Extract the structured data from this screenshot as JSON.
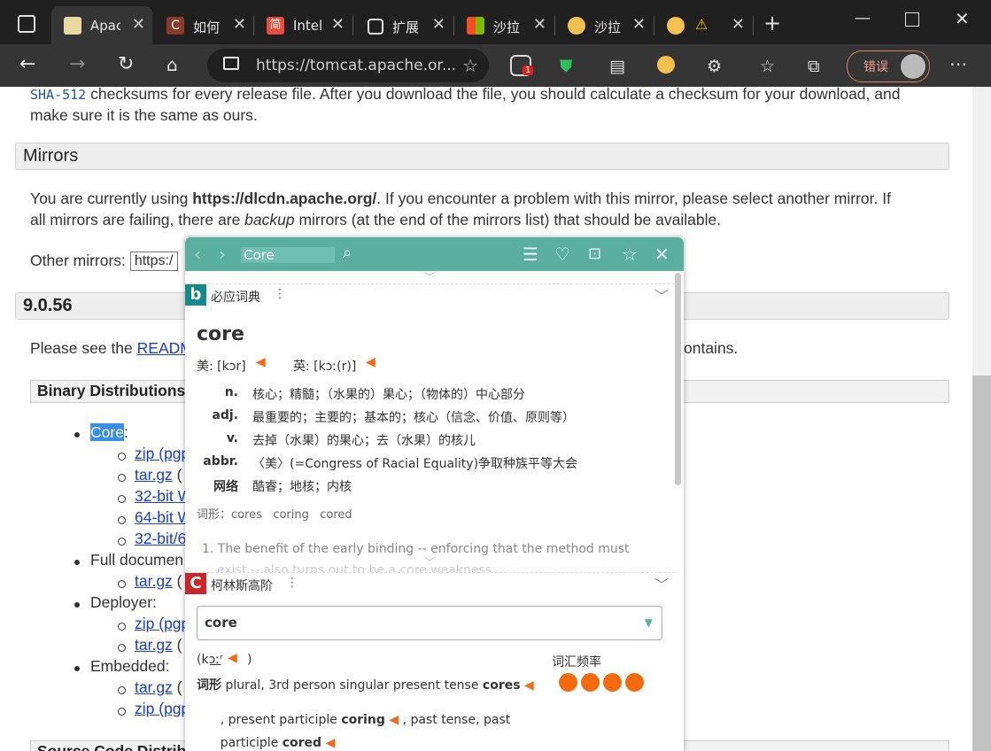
{
  "browser": {
    "tabs": [
      {
        "label": "Apac",
        "icon": "tomcat-icon",
        "active": true
      },
      {
        "label": "如何",
        "icon": "c-icon"
      },
      {
        "label": "Intel",
        "icon": "jian-icon"
      },
      {
        "label": "扩展",
        "icon": "puzzle-icon"
      },
      {
        "label": "沙拉",
        "icon": "windows-icon"
      },
      {
        "label": "沙拉",
        "icon": "saladict-icon"
      },
      {
        "label": "",
        "icon": "saladict-icon"
      }
    ],
    "url": "https://tomcat.apache.or...",
    "badge_count": "1",
    "error_label": "错误"
  },
  "page": {
    "intro_line1_code": "SHA-512",
    "intro_line1_rest": " checksums for every release file. After you download the file, you should calculate a checksum for your download, and",
    "intro_line2": "make sure it is the same as ours.",
    "mirrors_heading": "Mirrors",
    "mirror_text1_a": "You are currently using ",
    "mirror_text1_b": "https://dlcdn.apache.org/",
    "mirror_text1_c": ". If you encounter a problem with this mirror, please select another mirror. If",
    "mirror_text2_a": "all mirrors are failing, there are ",
    "mirror_text2_b": "backup",
    "mirror_text2_c": " mirrors (at the end of the mirrors list) that should be available.",
    "other_mirrors_label": "Other mirrors:",
    "other_mirrors_value": "https:/",
    "version_heading": "9.0.56",
    "readme_a": "Please see the ",
    "readme_link": "READM",
    "readme_tail": "ontains.",
    "binary_heading": "Binary Distributions",
    "core_label": "Core",
    "core_colon": ":",
    "core_items": [
      "zip",
      "tar.gz",
      "32-bit W",
      "64-bit W",
      "32-bit/6"
    ],
    "core_suffixes": [
      " (pgp",
      " (",
      "",
      "",
      ""
    ],
    "full_doc_label": "Full documen",
    "full_doc_items": [
      "tar.gz"
    ],
    "deployer_label": "Deployer:",
    "deployer_items": [
      "zip",
      "tar.gz"
    ],
    "deployer_suffixes": [
      " (pgp",
      " ("
    ],
    "embedded_label": "Embedded:",
    "embedded_items": [
      "tar.gz",
      "zip"
    ],
    "embedded_suffixes": [
      " (",
      " (pgp"
    ],
    "source_heading": "Source Code Distrib"
  },
  "dict": {
    "search_value": "Core",
    "bing": {
      "name": "必应词典",
      "word": "core",
      "us_label": "美: [kɔr]",
      "uk_label": "英: [kɔː(r)]",
      "defs": [
        {
          "pos": "n.",
          "text": "核心；精髓；（水果的）果心；（物体的）中心部分"
        },
        {
          "pos": "adj.",
          "text": "最重要的；主要的；基本的；核心（信念、价值、原则等）"
        },
        {
          "pos": "v.",
          "text": "去掉（水果）的果心；去（水果）的核儿"
        },
        {
          "pos": "abbr.",
          "text": "〈美〉(=Congress of Racial Equality)争取种族平等大会"
        },
        {
          "pos": "网络",
          "text": "酷睿；地核；内核"
        }
      ],
      "forms": "词形：cores   coring   cored",
      "example": "1. The benefit of the early binding -- enforcing that the method must",
      "example2": "exist -- also turns out to be a core weakness."
    },
    "collins": {
      "name": "柯林斯高阶",
      "select_value": "core",
      "pron": "(kɔ͟ːʳ",
      "pron_close": ")",
      "freq_label": "词汇频率",
      "freq_dots": 4,
      "forms_label": "词形",
      "forms_a": " plural, 3rd person singular present tense ",
      "forms_b": "cores",
      "forms_c": ", present participle ",
      "forms_d": "coring",
      "forms_e": " , past tense, past",
      "forms_f": "participle ",
      "forms_g": "cored"
    }
  }
}
